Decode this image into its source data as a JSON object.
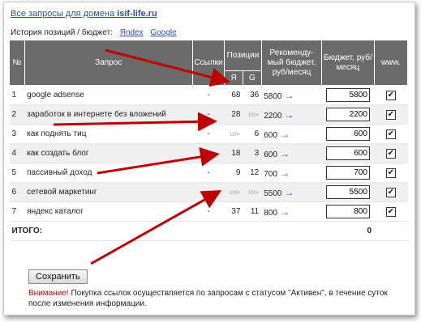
{
  "header": {
    "link_prefix": "Все запросы для домена",
    "domain": "isif-life.ru",
    "history_label": "История позиций / бюджет:",
    "history_links": [
      "Яndex",
      "Google"
    ]
  },
  "table": {
    "headers": {
      "num": "№",
      "query": "Запрос",
      "links": "Ссылки",
      "positions": "Позиции",
      "pos_ya": "Я",
      "pos_g": "G",
      "recommended": "Рекоменду-мый бюджет, руб/месяц",
      "budget": "Бюджет, руб/месяц",
      "www": "www."
    },
    "rows": [
      {
        "num": "1",
        "query": "google adsense",
        "links": "-",
        "ya": "68",
        "g": "36",
        "rec": "5800",
        "budget": "5800"
      },
      {
        "num": "2",
        "query": "заработок в интернете без вложений",
        "links": "-",
        "ya": "28",
        "g": "100+",
        "rec": "2200",
        "budget": "2200"
      },
      {
        "num": "3",
        "query": "как поднять тиц",
        "links": "-",
        "ya": "100+",
        "g": "6",
        "rec": "600",
        "budget": "600"
      },
      {
        "num": "4",
        "query": "как создать блог",
        "links": "-",
        "ya": "18",
        "g": "3",
        "rec": "600",
        "budget": "600"
      },
      {
        "num": "5",
        "query": "пассивный доход",
        "links": "-",
        "ya": "9",
        "g": "12",
        "rec": "700",
        "budget": "700"
      },
      {
        "num": "6",
        "query": "сетевой маркетинг",
        "links": "-",
        "ya": "100+",
        "g": "100+",
        "rec": "5500",
        "budget": "5500"
      },
      {
        "num": "7",
        "query": "яндекс каталог",
        "links": "-",
        "ya": "37",
        "g": "11",
        "rec": "800",
        "budget": "800"
      }
    ],
    "total_label": "ИТОГО:",
    "total_value": "0"
  },
  "save_label": "Сохранить",
  "notice": {
    "warn": "Внимание!",
    "text": " Покупка ссылок осуществляется по запросам с статусом \"Активен\", в течение суток после изменения информации."
  },
  "colors": {
    "arrow": "#c00000",
    "header_bg": "#6b6b6b",
    "link": "#2a4fb0"
  }
}
